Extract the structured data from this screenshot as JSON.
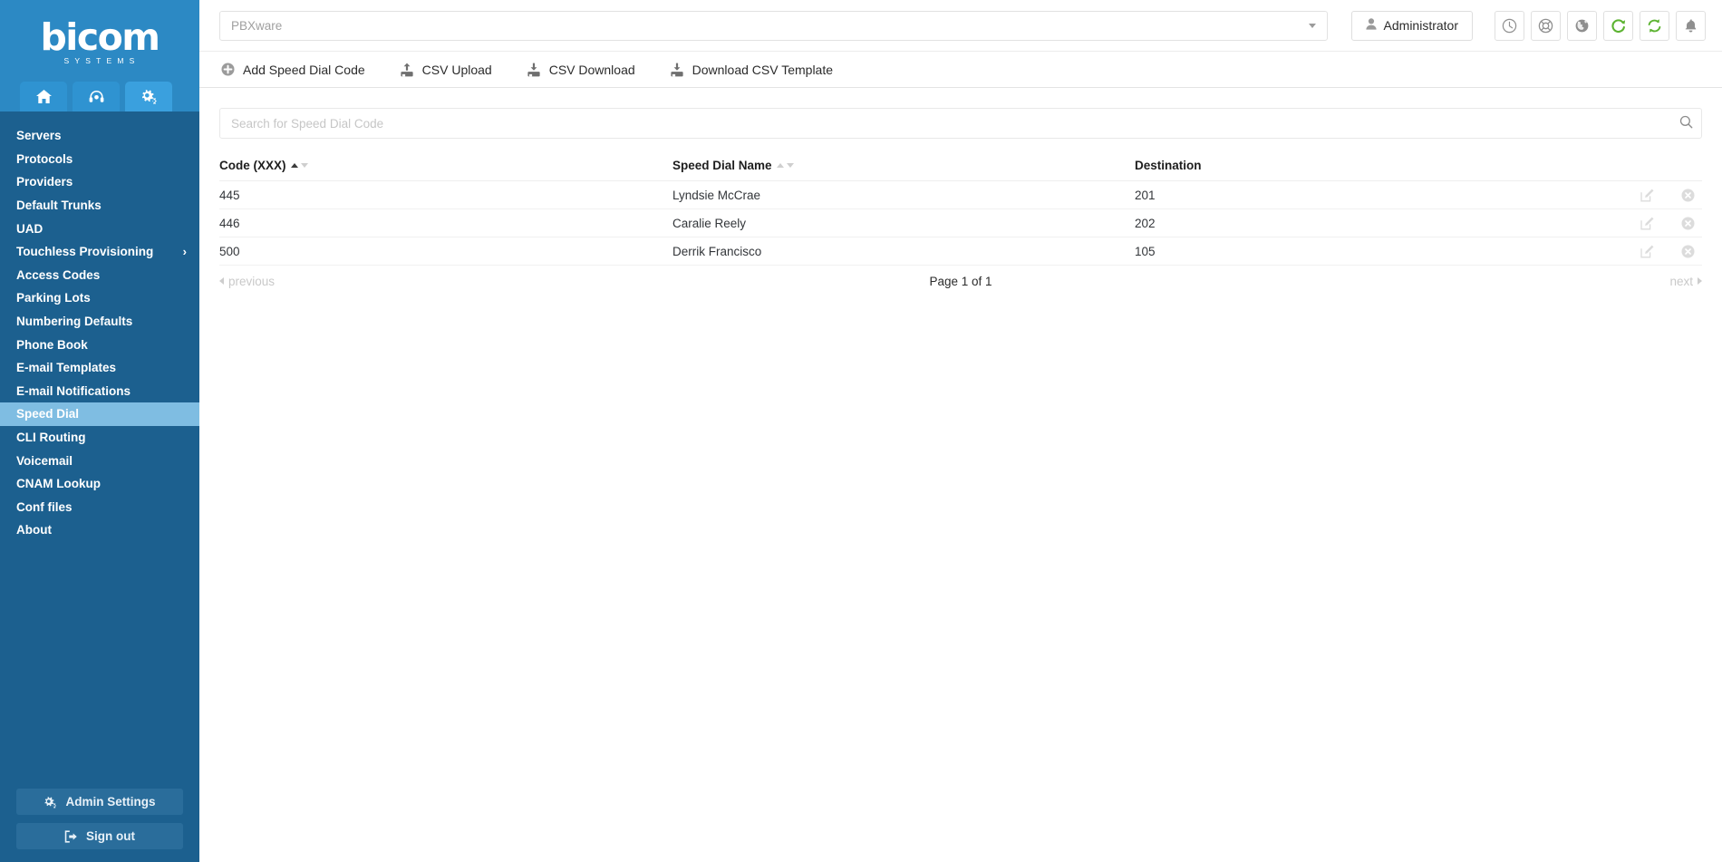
{
  "brand": {
    "name": "bicom",
    "tagline": "SYSTEMS"
  },
  "sidebar": {
    "tabs": [
      {
        "name": "home",
        "icon": "home-icon"
      },
      {
        "name": "support",
        "icon": "headset-icon"
      },
      {
        "name": "settings",
        "icon": "gears-icon",
        "active": true
      }
    ],
    "items": [
      {
        "label": "Servers",
        "active": false,
        "has_submenu": false
      },
      {
        "label": "Protocols",
        "active": false,
        "has_submenu": false
      },
      {
        "label": "Providers",
        "active": false,
        "has_submenu": false
      },
      {
        "label": "Default Trunks",
        "active": false,
        "has_submenu": false
      },
      {
        "label": "UAD",
        "active": false,
        "has_submenu": false
      },
      {
        "label": "Touchless Provisioning",
        "active": false,
        "has_submenu": true
      },
      {
        "label": "Access Codes",
        "active": false,
        "has_submenu": false
      },
      {
        "label": "Parking Lots",
        "active": false,
        "has_submenu": false
      },
      {
        "label": "Numbering Defaults",
        "active": false,
        "has_submenu": false
      },
      {
        "label": "Phone Book",
        "active": false,
        "has_submenu": false
      },
      {
        "label": "E-mail Templates",
        "active": false,
        "has_submenu": false
      },
      {
        "label": "E-mail Notifications",
        "active": false,
        "has_submenu": false
      },
      {
        "label": "Speed Dial",
        "active": true,
        "has_submenu": false
      },
      {
        "label": "CLI Routing",
        "active": false,
        "has_submenu": false
      },
      {
        "label": "Voicemail",
        "active": false,
        "has_submenu": false
      },
      {
        "label": "CNAM Lookup",
        "active": false,
        "has_submenu": false
      },
      {
        "label": "Conf files",
        "active": false,
        "has_submenu": false
      },
      {
        "label": "About",
        "active": false,
        "has_submenu": false
      }
    ],
    "admin_settings_label": "Admin Settings",
    "sign_out_label": "Sign out"
  },
  "topbar": {
    "server_value": "PBXware",
    "user_label": "Administrator",
    "icons": [
      {
        "name": "clock-icon"
      },
      {
        "name": "lifebuoy-icon"
      },
      {
        "name": "globe-icon"
      },
      {
        "name": "reload-icon"
      },
      {
        "name": "sync-icon"
      },
      {
        "name": "bell-icon"
      }
    ]
  },
  "toolbar": {
    "add_label": "Add Speed Dial Code",
    "csv_upload_label": "CSV Upload",
    "csv_download_label": "CSV Download",
    "csv_template_label": "Download CSV Template"
  },
  "search": {
    "placeholder": "Search for Speed Dial Code",
    "value": ""
  },
  "table": {
    "columns": [
      {
        "label": "Code (XXX)",
        "sortable": true,
        "sort": "asc"
      },
      {
        "label": "Speed Dial Name",
        "sortable": true,
        "sort": "none"
      },
      {
        "label": "Destination",
        "sortable": false,
        "sort": "none"
      }
    ],
    "rows": [
      {
        "code": "445",
        "name": "Lyndsie McCrae",
        "destination": "201"
      },
      {
        "code": "446",
        "name": "Caralie Reely",
        "destination": "202"
      },
      {
        "code": "500",
        "name": "Derrik Francisco",
        "destination": "105"
      }
    ],
    "row_actions": [
      {
        "name": "edit-icon"
      },
      {
        "name": "delete-icon"
      }
    ]
  },
  "pagination": {
    "previous_label": "previous",
    "page_label": "Page 1 of 1",
    "next_label": "next"
  },
  "colors": {
    "sidebar_bg": "#1c608f",
    "sidebar_header_bg": "#2c89c4",
    "sidebar_active": "#7fbde2",
    "accent_green": "#5cb331",
    "text": "#2b2b2b",
    "muted": "#c6c6c6"
  }
}
